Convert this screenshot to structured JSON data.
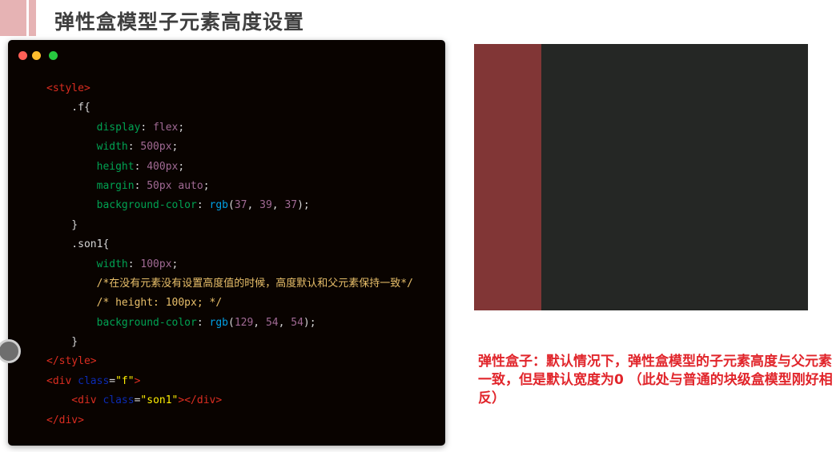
{
  "title": "弹性盒模型子元素高度设置",
  "code_window": {
    "lines": [
      [
        {
          "c": "tag",
          "t": "<style>"
        }
      ],
      [
        {
          "c": "sel",
          "t": "    .f{"
        }
      ],
      [
        {
          "c": "prop",
          "t": "        display"
        },
        {
          "c": "punct",
          "t": ": "
        },
        {
          "c": "val",
          "t": "flex"
        },
        {
          "c": "punct",
          "t": ";"
        }
      ],
      [
        {
          "c": "prop",
          "t": "        width"
        },
        {
          "c": "punct",
          "t": ": "
        },
        {
          "c": "num",
          "t": "500px"
        },
        {
          "c": "punct",
          "t": ";"
        }
      ],
      [
        {
          "c": "prop",
          "t": "        height"
        },
        {
          "c": "punct",
          "t": ": "
        },
        {
          "c": "num",
          "t": "400px"
        },
        {
          "c": "punct",
          "t": ";"
        }
      ],
      [
        {
          "c": "prop",
          "t": "        margin"
        },
        {
          "c": "punct",
          "t": ": "
        },
        {
          "c": "num",
          "t": "50px auto"
        },
        {
          "c": "punct",
          "t": ";"
        }
      ],
      [
        {
          "c": "prop",
          "t": "        background-color"
        },
        {
          "c": "punct",
          "t": ": "
        },
        {
          "c": "fn",
          "t": "rgb"
        },
        {
          "c": "punct",
          "t": "("
        },
        {
          "c": "num",
          "t": "37"
        },
        {
          "c": "punct",
          "t": ", "
        },
        {
          "c": "num",
          "t": "39"
        },
        {
          "c": "punct",
          "t": ", "
        },
        {
          "c": "num",
          "t": "37"
        },
        {
          "c": "punct",
          "t": ");"
        }
      ],
      [
        {
          "c": "sel",
          "t": "    }"
        }
      ],
      [
        {
          "c": "sel",
          "t": "    .son1{"
        }
      ],
      [
        {
          "c": "prop",
          "t": "        width"
        },
        {
          "c": "punct",
          "t": ": "
        },
        {
          "c": "num",
          "t": "100px"
        },
        {
          "c": "punct",
          "t": ";"
        }
      ],
      [
        {
          "c": "cmt",
          "t": "        /*在没有元素没有设置高度值的时候，高度默认和父元素保持一致*/"
        }
      ],
      [
        {
          "c": "cmt",
          "t": "        /* height: 100px; */"
        }
      ],
      [
        {
          "c": "prop",
          "t": "        background-color"
        },
        {
          "c": "punct",
          "t": ": "
        },
        {
          "c": "fn",
          "t": "rgb"
        },
        {
          "c": "punct",
          "t": "("
        },
        {
          "c": "num",
          "t": "129"
        },
        {
          "c": "punct",
          "t": ", "
        },
        {
          "c": "num",
          "t": "54"
        },
        {
          "c": "punct",
          "t": ", "
        },
        {
          "c": "num",
          "t": "54"
        },
        {
          "c": "punct",
          "t": ");"
        }
      ],
      [
        {
          "c": "sel",
          "t": "    }"
        }
      ],
      [
        {
          "c": "tag",
          "t": "</style>"
        }
      ],
      [
        {
          "c": "tag",
          "t": "<div "
        },
        {
          "c": "attr",
          "t": "class"
        },
        {
          "c": "punct",
          "t": "="
        },
        {
          "c": "str",
          "t": "\"f\""
        },
        {
          "c": "tag",
          "t": ">"
        }
      ],
      [
        {
          "c": "tag",
          "t": "    <div "
        },
        {
          "c": "attr",
          "t": "class"
        },
        {
          "c": "punct",
          "t": "="
        },
        {
          "c": "str",
          "t": "\"son1\""
        },
        {
          "c": "tag",
          "t": "></div>"
        }
      ],
      [
        {
          "c": "tag",
          "t": "</div>"
        }
      ]
    ]
  },
  "note_text": "弹性盒子：默认情况下，弹性盒模型的子元素高度与父元素一致，但是默认宽度为0 （此处与普通的块级盒模型刚好相反）"
}
